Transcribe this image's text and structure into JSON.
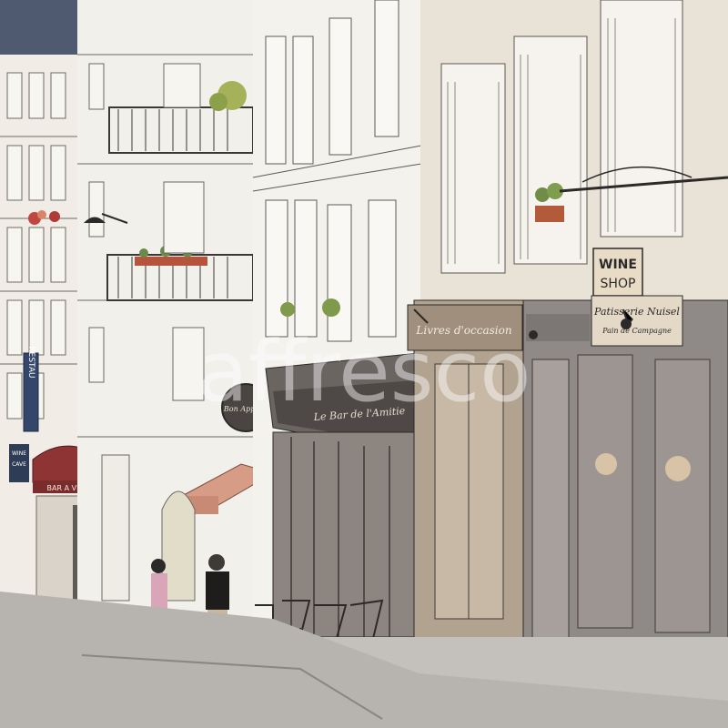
{
  "signs": {
    "wine_shop_line1": "WINE",
    "wine_shop_line2": "SHOP",
    "livres": "Livres d'occasion",
    "patisserie": "Patisserie Nuisel",
    "pain": "Pain de Campagne",
    "bar_a_vin": "BAR A VIN",
    "restau": "RESTAU",
    "cafe_round": "Bon Appetit",
    "awning_cafe": "Le Bar de l'Amitie",
    "wine_small_1": "WINE",
    "wine_small_2": "CAVE"
  },
  "watermark": "affresco",
  "colors": {
    "sky": "#f1eee8",
    "facade_light": "#f3f1ec",
    "facade_warm": "#e7ded0",
    "shop_brown": "#9b8b7a",
    "shop_grey": "#8f8a88",
    "awning_red": "#8e3434",
    "awning_salmon": "#d79c86",
    "street": "#b9b6b2",
    "ink": "#2c2a28"
  }
}
